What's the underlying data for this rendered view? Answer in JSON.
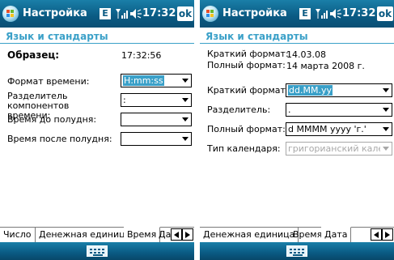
{
  "left": {
    "window_title": "Настройка",
    "status_e": "E",
    "clock": "17:32",
    "ok_label": "ok",
    "section_title": "Язык и стандарты",
    "sample_label": "Образец:",
    "sample_value": "17:32:56",
    "fields": [
      {
        "label": "Формат времени:",
        "value": "H:mm:ss",
        "selected": true
      },
      {
        "label": "Разделитель компонентов времени:",
        "value": ":",
        "selected": false
      },
      {
        "label": "Время до полудня:",
        "value": "",
        "selected": false
      },
      {
        "label": "Время после полудня:",
        "value": "",
        "selected": false
      }
    ],
    "tabs": [
      "Число",
      "Денежная единица",
      "Время",
      "Да"
    ],
    "active_tab": "Время"
  },
  "right": {
    "window_title": "Настройка",
    "status_e": "E",
    "clock": "17:32",
    "ok_label": "ok",
    "section_title": "Язык и стандарты",
    "short_format_label": "Краткий формат:",
    "short_format_value": "14.03.08",
    "long_format_label": "Полный формат:",
    "long_format_value": "14 марта 2008 г.",
    "fields": [
      {
        "label": "Краткий формат:",
        "value": "dd.MM.yy",
        "selected": true
      },
      {
        "label": "Разделитель:",
        "value": ".",
        "selected": false
      },
      {
        "label": "Полный формат:",
        "value": "d MMMM yyyy 'г.'",
        "selected": false
      },
      {
        "label": "Тип календаря:",
        "value": "григорианский кале",
        "selected": false,
        "disabled": true
      }
    ],
    "tabs": [
      "Денежная единица",
      "Время",
      "Дата"
    ],
    "active_tab": "Дата"
  },
  "colors": {
    "accent": "#3aa0c8",
    "titlebar": "#0a5a83"
  }
}
